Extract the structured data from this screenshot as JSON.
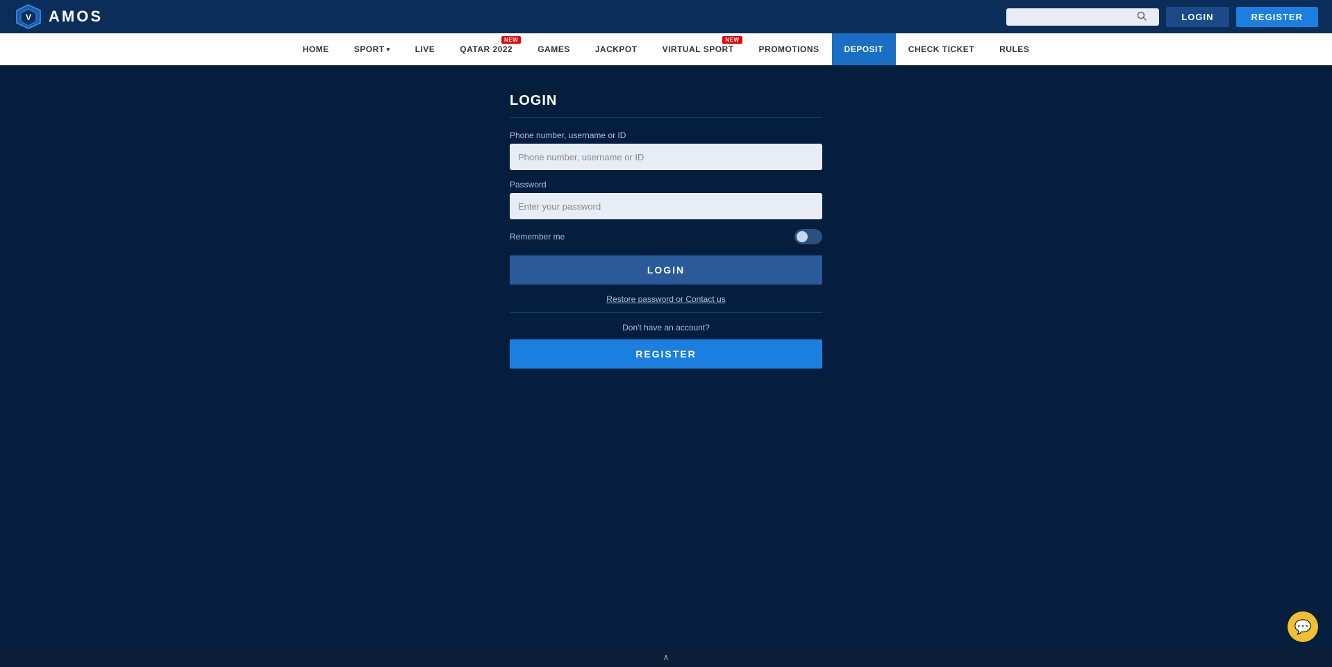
{
  "header": {
    "logo_text": "AMOS",
    "search_placeholder": "",
    "login_button": "LOGIN",
    "register_button": "REGISTER"
  },
  "navbar": {
    "items": [
      {
        "label": "HOME",
        "has_badge": false,
        "active": false
      },
      {
        "label": "SPORT",
        "has_chevron": true,
        "has_badge": false,
        "active": false
      },
      {
        "label": "LIVE",
        "has_badge": false,
        "active": false
      },
      {
        "label": "QATAR 2022",
        "has_badge": true,
        "badge_text": "NEW",
        "active": false
      },
      {
        "label": "GAMES",
        "has_badge": false,
        "active": false
      },
      {
        "label": "JACKPOT",
        "has_badge": false,
        "active": false
      },
      {
        "label": "VIRTUAL SPORT",
        "has_badge": true,
        "badge_text": "NEW",
        "active": false
      },
      {
        "label": "PROMOTIONS",
        "has_badge": false,
        "active": false
      },
      {
        "label": "DEPOSIT",
        "has_badge": false,
        "active": true
      },
      {
        "label": "CHECK TICKET",
        "has_badge": false,
        "active": false
      },
      {
        "label": "RULES",
        "has_badge": false,
        "active": false
      }
    ]
  },
  "login_form": {
    "title": "LOGIN",
    "username_label": "Phone number, username or ID",
    "username_placeholder": "Phone number, username or ID",
    "password_label": "Password",
    "password_placeholder": "Enter your password",
    "remember_label": "Remember me",
    "login_button": "LOGIN",
    "restore_link": "Restore password or Contact us",
    "no_account_text": "Don't have an account?",
    "register_button": "REGISTER"
  },
  "footer": {
    "chevron": "∧"
  },
  "chat": {
    "icon": "💬"
  }
}
